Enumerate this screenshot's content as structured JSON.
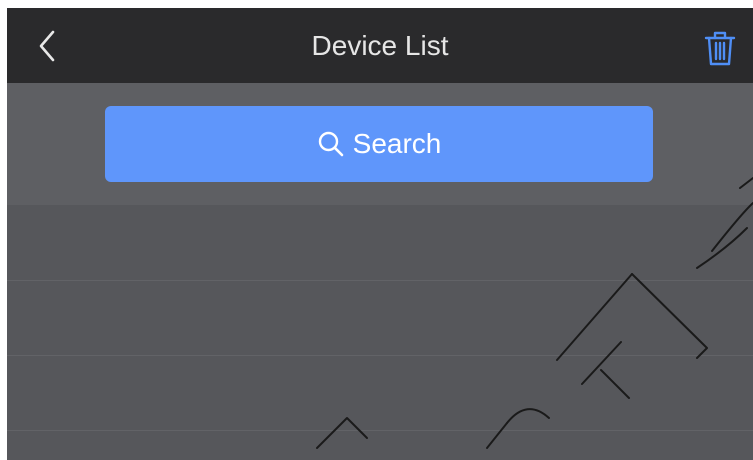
{
  "header": {
    "title": "Device List",
    "back_icon": "chevron-left-icon",
    "delete_icon": "trash-icon"
  },
  "search": {
    "label": "Search",
    "icon": "search-icon"
  },
  "device_rows": [
    {
      "name": ""
    },
    {
      "name": ""
    },
    {
      "name": ""
    }
  ],
  "colors": {
    "titlebar": "#2a2a2c",
    "background": "#56575b",
    "search_area": "#5e5f63",
    "accent": "#5f96fb",
    "title_text": "#e6e6e6",
    "trash_icon": "#4f8ef5"
  }
}
